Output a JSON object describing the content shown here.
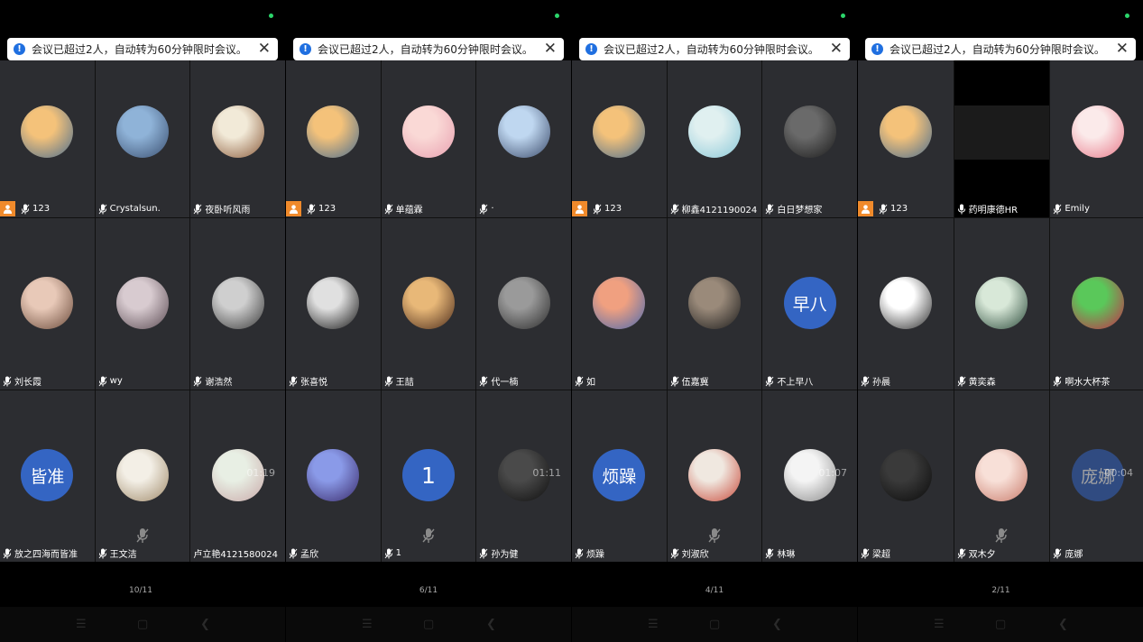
{
  "banner_text": "会议已超过2人，自动转为60分钟限时会议。",
  "panels": [
    {
      "page": "10/11",
      "tiles": [
        {
          "name": "123",
          "host": true,
          "avatar": {
            "kind": "img",
            "c1": "#f4c27a",
            "c2": "#4a6d8f"
          }
        },
        {
          "name": "Crystalsun.",
          "avatar": {
            "kind": "img",
            "c1": "#8fb3d8",
            "c2": "#3a4f70"
          }
        },
        {
          "name": "夜卧听风雨",
          "avatar": {
            "kind": "img",
            "c1": "#f2ead8",
            "c2": "#8a5a3a"
          }
        },
        {
          "name": "刘长霞",
          "avatar": {
            "kind": "img",
            "c1": "#e8c9b8",
            "c2": "#6a4a3a"
          }
        },
        {
          "name": "wy",
          "avatar": {
            "kind": "img",
            "c1": "#d8cbd0",
            "c2": "#5a4a52"
          }
        },
        {
          "name": "谢浩然",
          "avatar": {
            "kind": "img",
            "c1": "#cfcfcf",
            "c2": "#3a3a3a"
          }
        },
        {
          "name": "放之四海而皆准",
          "avatar": {
            "kind": "text",
            "text": "皆准"
          }
        },
        {
          "name": "王文洁",
          "avatar": {
            "kind": "img",
            "c1": "#f3efe6",
            "c2": "#a08a6a"
          },
          "bigmic": true
        },
        {
          "name": "卢立艳4121580024",
          "avatar": {
            "kind": "img",
            "c1": "#e8efe4",
            "c2": "#c8a8a8"
          },
          "timer": "01:19",
          "nomic": true
        }
      ]
    },
    {
      "page": "6/11",
      "tiles": [
        {
          "name": "123",
          "host": true,
          "avatar": {
            "kind": "img",
            "c1": "#f4c27a",
            "c2": "#4a6d8f"
          }
        },
        {
          "name": "单蕴霖",
          "avatar": {
            "kind": "img",
            "c1": "#fad9d6",
            "c2": "#e8a0b0"
          }
        },
        {
          "name": "·",
          "avatar": {
            "kind": "img",
            "c1": "#bfd7f0",
            "c2": "#3a4a6a"
          }
        },
        {
          "name": "张喜悦",
          "avatar": {
            "kind": "img",
            "c1": "#e0e0e0",
            "c2": "#151515"
          }
        },
        {
          "name": "王喆",
          "avatar": {
            "kind": "img",
            "c1": "#e8b878",
            "c2": "#4a2a1a"
          }
        },
        {
          "name": "代一楠",
          "avatar": {
            "kind": "img",
            "c1": "#9a9a9a",
            "c2": "#2a2a2a"
          }
        },
        {
          "name": "孟欣",
          "avatar": {
            "kind": "img",
            "c1": "#8a9ae8",
            "c2": "#3a2a6a"
          }
        },
        {
          "name": "1",
          "avatar": {
            "kind": "text",
            "text": "1",
            "number": true
          },
          "bigmic": true
        },
        {
          "name": "孙为健",
          "avatar": {
            "kind": "img",
            "c1": "#4a4a4a",
            "c2": "#0e0e0e"
          },
          "timer": "01:11"
        }
      ]
    },
    {
      "page": "4/11",
      "tiles": [
        {
          "name": "123",
          "host": true,
          "avatar": {
            "kind": "img",
            "c1": "#f4c27a",
            "c2": "#4a6d8f"
          }
        },
        {
          "name": "柳鑫4121190024",
          "avatar": {
            "kind": "img",
            "c1": "#e0f0f0",
            "c2": "#8ac8d8"
          }
        },
        {
          "name": "白日梦想家",
          "avatar": {
            "kind": "img",
            "c1": "#6a6a6a",
            "c2": "#1a1a1a"
          }
        },
        {
          "name": "如",
          "avatar": {
            "kind": "img",
            "c1": "#f0a080",
            "c2": "#4a6ab0"
          }
        },
        {
          "name": "伍嘉冀",
          "avatar": {
            "kind": "img",
            "c1": "#9a8a7a",
            "c2": "#1a1a1a"
          }
        },
        {
          "name": "不上早八",
          "avatar": {
            "kind": "text",
            "text": "早八"
          }
        },
        {
          "name": "烦躁",
          "avatar": {
            "kind": "text",
            "text": "烦躁"
          }
        },
        {
          "name": "刘淑欣",
          "avatar": {
            "kind": "img",
            "c1": "#f0e8e0",
            "c2": "#c84a3a"
          },
          "bigmic": true
        },
        {
          "name": "林琳",
          "avatar": {
            "kind": "img",
            "c1": "#f4f4f4",
            "c2": "#8a8a8a"
          },
          "timer": "01:07"
        }
      ]
    },
    {
      "page": "2/11",
      "tiles": [
        {
          "name": "123",
          "host": true,
          "avatar": {
            "kind": "img",
            "c1": "#f4c27a",
            "c2": "#4a6d8f"
          }
        },
        {
          "name": "药明康德HR",
          "avatar": {
            "kind": "none"
          },
          "black": true
        },
        {
          "name": "Emily",
          "avatar": {
            "kind": "img",
            "c1": "#fbeaea",
            "c2": "#e87a8a"
          }
        },
        {
          "name": "孙晨",
          "avatar": {
            "kind": "img",
            "c1": "#ffffff",
            "c2": "#2a2a2a"
          }
        },
        {
          "name": "黄奕森",
          "avatar": {
            "kind": "img",
            "c1": "#d8e8d8",
            "c2": "#2a4a3a"
          }
        },
        {
          "name": "啊水大杯茶",
          "avatar": {
            "kind": "img",
            "c1": "#5ac85a",
            "c2": "#c8284a"
          }
        },
        {
          "name": "梁超",
          "avatar": {
            "kind": "img",
            "c1": "#3a3a3a",
            "c2": "#0a0a0a"
          }
        },
        {
          "name": "双木夕",
          "avatar": {
            "kind": "img",
            "c1": "#f8e0d8",
            "c2": "#c87a6a"
          },
          "bigmic": true
        },
        {
          "name": "庞娜",
          "avatar": {
            "kind": "text",
            "text": "庞娜",
            "faded": true
          },
          "timer": "00:04"
        }
      ]
    }
  ]
}
